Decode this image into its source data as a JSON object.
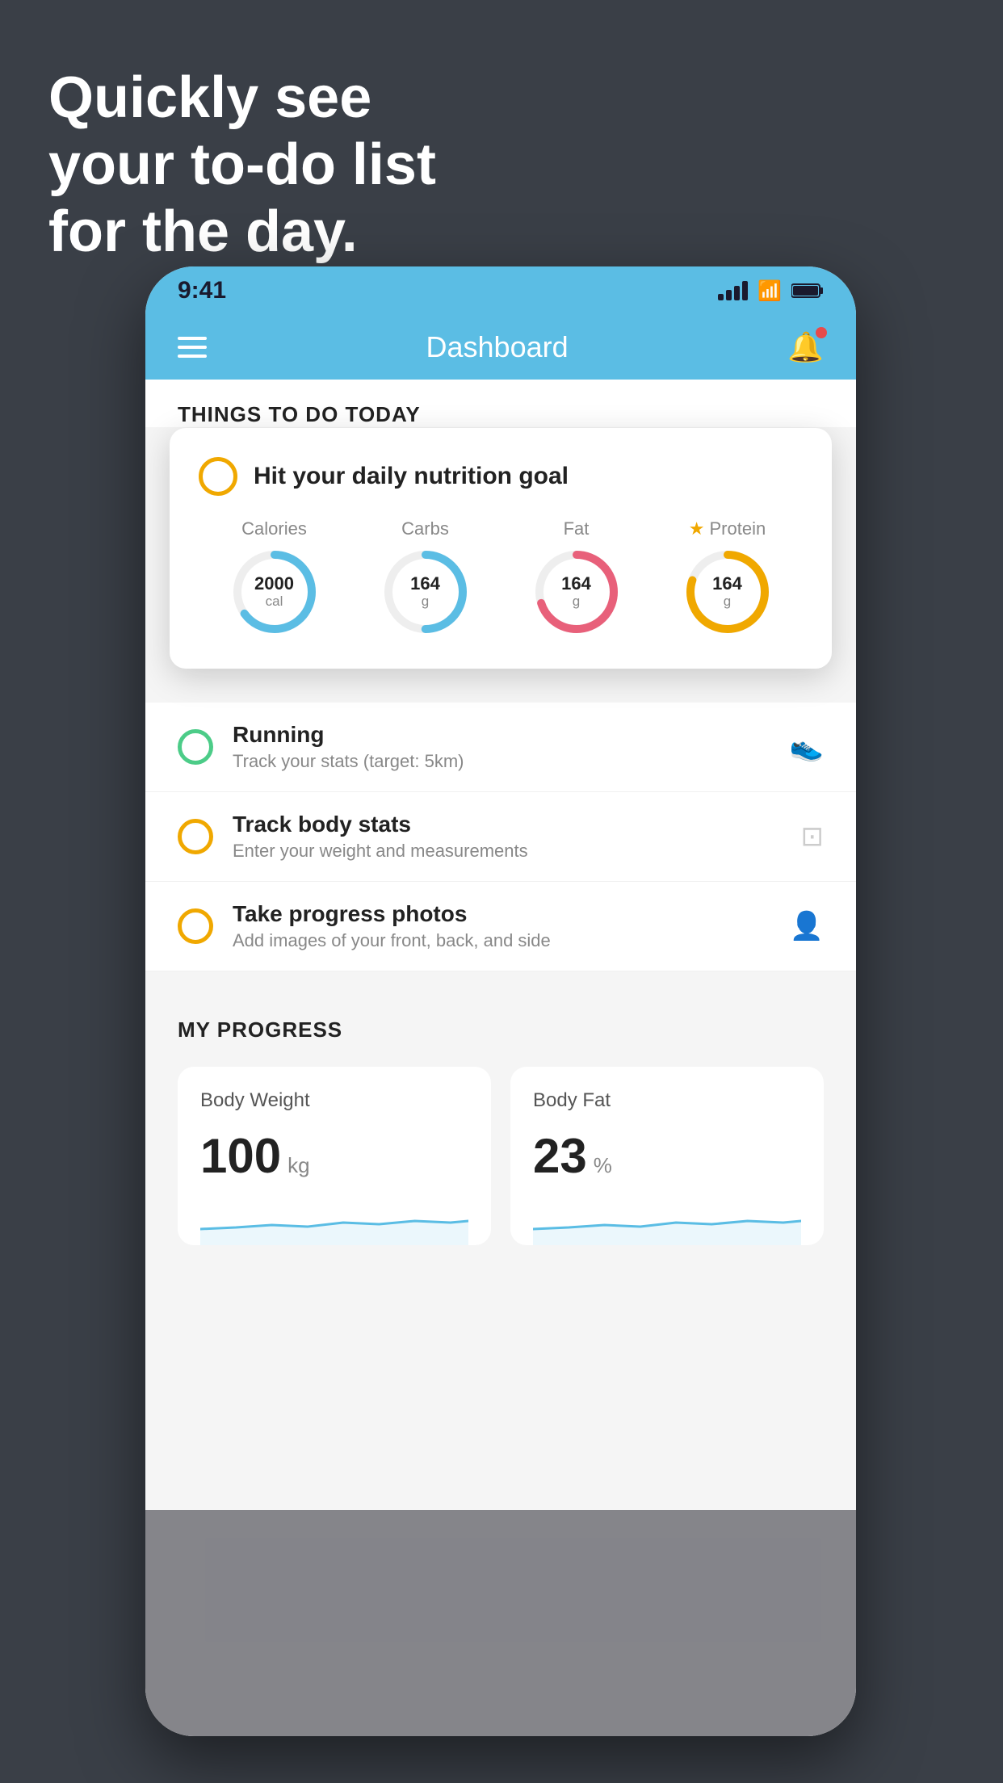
{
  "hero": {
    "line1": "Quickly see",
    "line2": "your to-do list",
    "line3": "for the day."
  },
  "status_bar": {
    "time": "9:41"
  },
  "nav": {
    "title": "Dashboard"
  },
  "things_section": {
    "title": "THINGS TO DO TODAY"
  },
  "floating_card": {
    "title": "Hit your daily nutrition goal",
    "macros": [
      {
        "label": "Calories",
        "value": "2000",
        "unit": "cal",
        "color": "#5bbde4",
        "pct": 65,
        "starred": false
      },
      {
        "label": "Carbs",
        "value": "164",
        "unit": "g",
        "color": "#5bbde4",
        "pct": 50,
        "starred": false
      },
      {
        "label": "Fat",
        "value": "164",
        "unit": "g",
        "color": "#e8607a",
        "pct": 70,
        "starred": false
      },
      {
        "label": "Protein",
        "value": "164",
        "unit": "g",
        "color": "#f0a800",
        "pct": 80,
        "starred": true
      }
    ]
  },
  "todo_items": [
    {
      "title": "Running",
      "subtitle": "Track your stats (target: 5km)",
      "circle_color": "green",
      "icon": "👟"
    },
    {
      "title": "Track body stats",
      "subtitle": "Enter your weight and measurements",
      "circle_color": "yellow",
      "icon": "⊡"
    },
    {
      "title": "Take progress photos",
      "subtitle": "Add images of your front, back, and side",
      "circle_color": "yellow",
      "icon": "👤"
    }
  ],
  "progress_section": {
    "title": "MY PROGRESS",
    "cards": [
      {
        "label": "Body Weight",
        "value": "100",
        "unit": "kg"
      },
      {
        "label": "Body Fat",
        "value": "23",
        "unit": "%"
      }
    ]
  }
}
